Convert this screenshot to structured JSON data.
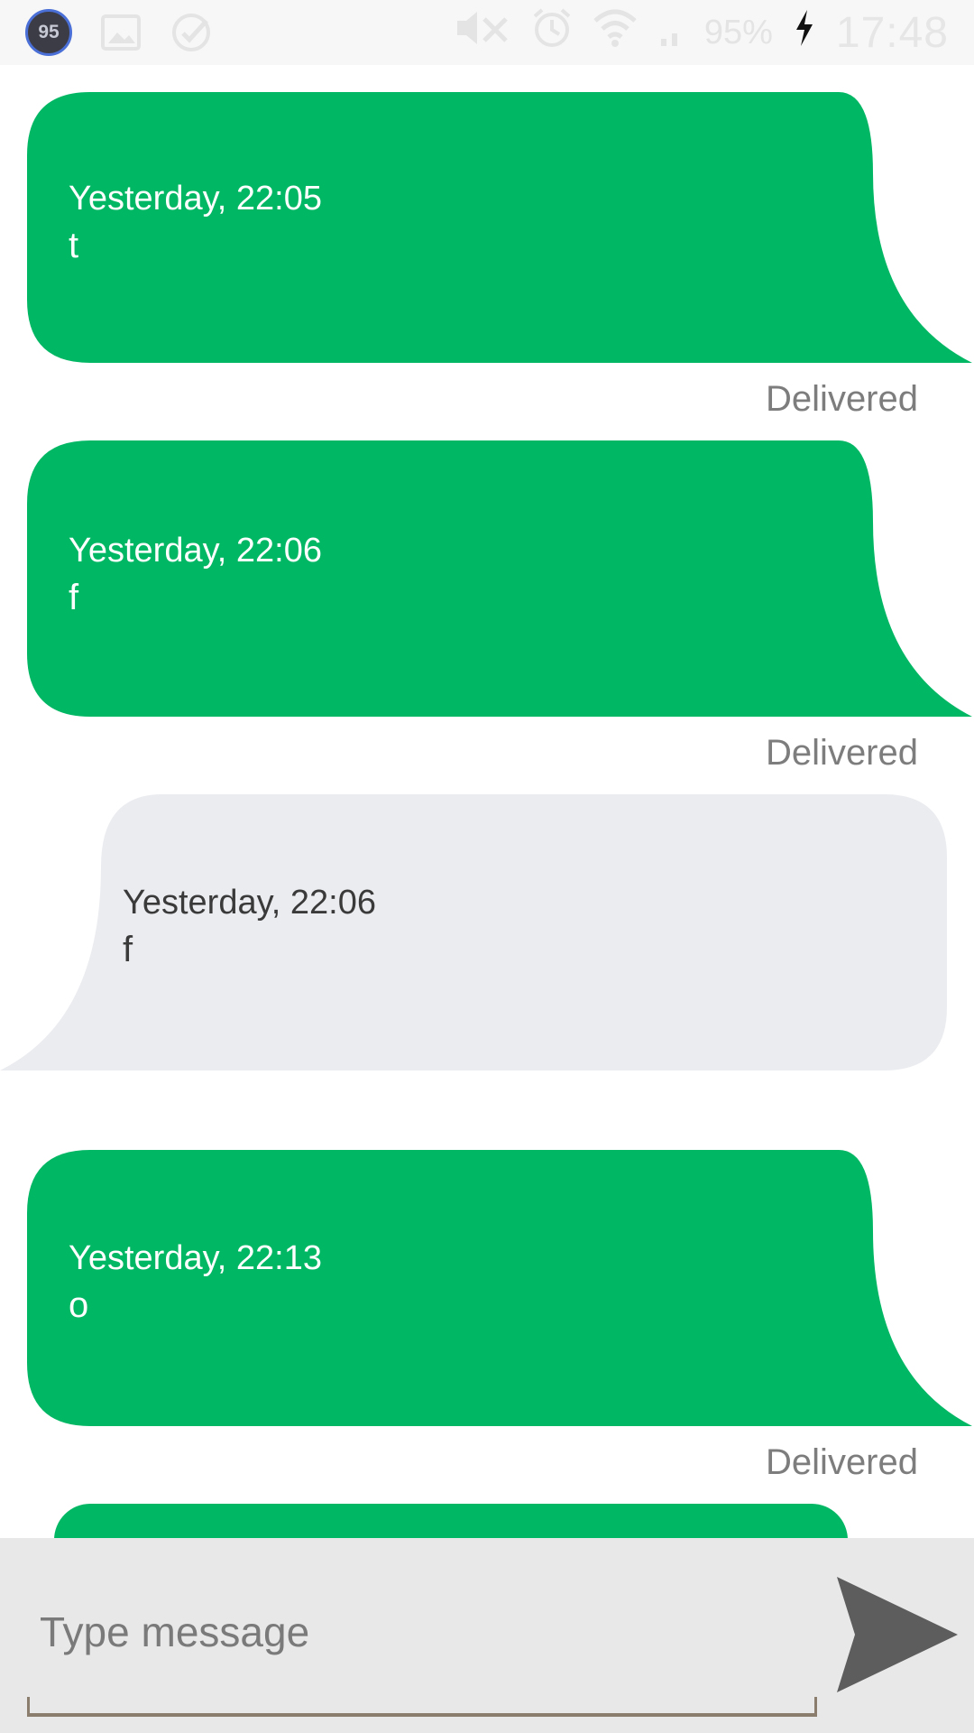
{
  "status_bar": {
    "notification_badge": "95",
    "battery_percent": "95%",
    "time": "17:48",
    "icons": [
      "gallery-icon",
      "shield-check-icon",
      "mute-icon",
      "alarm-icon",
      "wifi-icon",
      "signal-icon",
      "charging-icon"
    ]
  },
  "colors": {
    "sent_bubble": "#00b764",
    "received_bubble": "#ebecf0",
    "composer_bg": "#e8e8e8",
    "send_icon": "#5d5d5d"
  },
  "messages": [
    {
      "direction": "sent",
      "time": "Yesterday, 22:05",
      "text": "t",
      "status": "Delivered"
    },
    {
      "direction": "sent",
      "time": "Yesterday, 22:06",
      "text": "f",
      "status": "Delivered"
    },
    {
      "direction": "received",
      "time": "Yesterday, 22:06",
      "text": "f"
    },
    {
      "direction": "sent",
      "time": "Yesterday, 22:13",
      "text": "o",
      "status": "Delivered"
    }
  ],
  "composer": {
    "placeholder": "Type message",
    "value": "",
    "send_icon": "send-icon"
  }
}
